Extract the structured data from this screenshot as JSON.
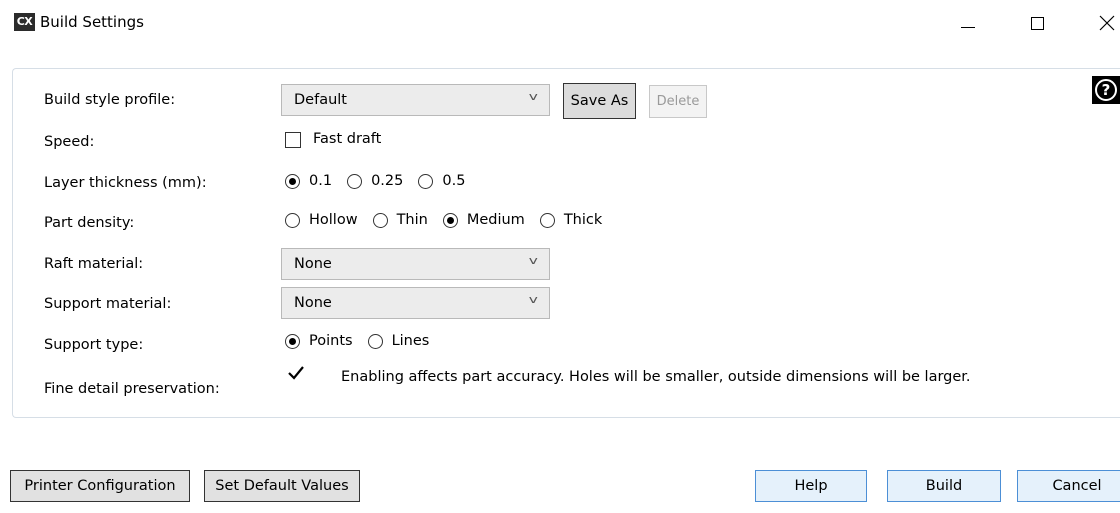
{
  "window": {
    "logo": "CX",
    "title": "Build Settings"
  },
  "labels": {
    "profile": "Build style profile:",
    "speed": "Speed:",
    "layer": "Layer thickness (mm):",
    "density": "Part density:",
    "raft": "Raft material:",
    "support_material": "Support material:",
    "support_type": "Support type:",
    "fine_detail": "Fine detail preservation:"
  },
  "profile": {
    "value": "Default",
    "save_as": "Save As",
    "delete": "Delete"
  },
  "speed": {
    "label": "Fast draft",
    "checked": false
  },
  "layer_thickness": {
    "options": [
      "0.1",
      "0.25",
      "0.5"
    ],
    "selected": "0.1"
  },
  "part_density": {
    "options": [
      "Hollow",
      "Thin",
      "Medium",
      "Thick"
    ],
    "selected": "Medium"
  },
  "raft_material": {
    "value": "None"
  },
  "support_material": {
    "value": "None"
  },
  "support_type": {
    "options": [
      "Points",
      "Lines"
    ],
    "selected": "Points"
  },
  "fine_detail": {
    "checked": true,
    "text": "Enabling affects part accuracy. Holes will be smaller, outside dimensions will be larger."
  },
  "footer": {
    "printer_configuration": "Printer Configuration",
    "set_default_values": "Set Default Values",
    "help": "Help",
    "build": "Build",
    "cancel": "Cancel"
  },
  "icons": {
    "dropdown": "chevron-down-icon",
    "help": "question-circle-icon",
    "check": "checkmark-icon"
  }
}
